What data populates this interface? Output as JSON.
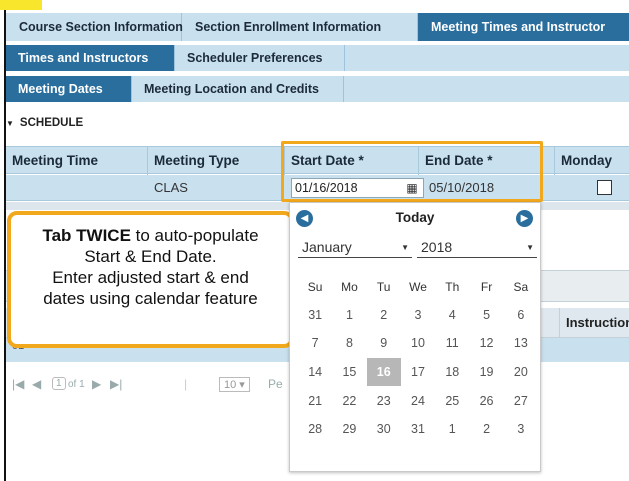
{
  "tabs_row1": [
    "Course Section Information",
    "Section Enrollment Information",
    "Meeting Times and Instructor"
  ],
  "tabs_row2": [
    "Times and Instructors",
    "Scheduler Preferences"
  ],
  "tabs_row3": [
    "Meeting Dates",
    "Meeting Location and Credits"
  ],
  "section_label": "SCHEDULE",
  "table": {
    "headers": [
      "Meeting Time",
      "Meeting Type",
      "Start Date *",
      "End Date *",
      "Monday"
    ],
    "row": {
      "meeting_type": "CLAS",
      "start_date": "01/16/2018",
      "end_date": "05/10/2018"
    }
  },
  "lower_table": {
    "header_instructor": "Instruction",
    "row_value": "01"
  },
  "pager": {
    "page": "1",
    "of": "of 1",
    "page_size": "10",
    "per_page": "Pe"
  },
  "callout": {
    "bold": "Tab TWICE",
    "line1_rest": " to auto-populate",
    "line2": "Start & End Date.",
    "line3": "Enter adjusted start & end",
    "line4": "dates using calendar feature"
  },
  "calendar": {
    "today_label": "Today",
    "month": "January",
    "year": "2018",
    "days_of_week": [
      "Su",
      "Mo",
      "Tu",
      "We",
      "Th",
      "Fr",
      "Sa"
    ],
    "weeks": [
      [
        "31",
        "1",
        "2",
        "3",
        "4",
        "5",
        "6"
      ],
      [
        "7",
        "8",
        "9",
        "10",
        "11",
        "12",
        "13"
      ],
      [
        "14",
        "15",
        "16",
        "17",
        "18",
        "19",
        "20"
      ],
      [
        "21",
        "22",
        "23",
        "24",
        "25",
        "26",
        "27"
      ],
      [
        "28",
        "29",
        "30",
        "31",
        "1",
        "2",
        "3"
      ]
    ],
    "selected_day": "16"
  },
  "colors": {
    "tab_bg": "#c9e0ef",
    "active_tab": "#2a6e9e",
    "highlight": "#f2a81c"
  }
}
